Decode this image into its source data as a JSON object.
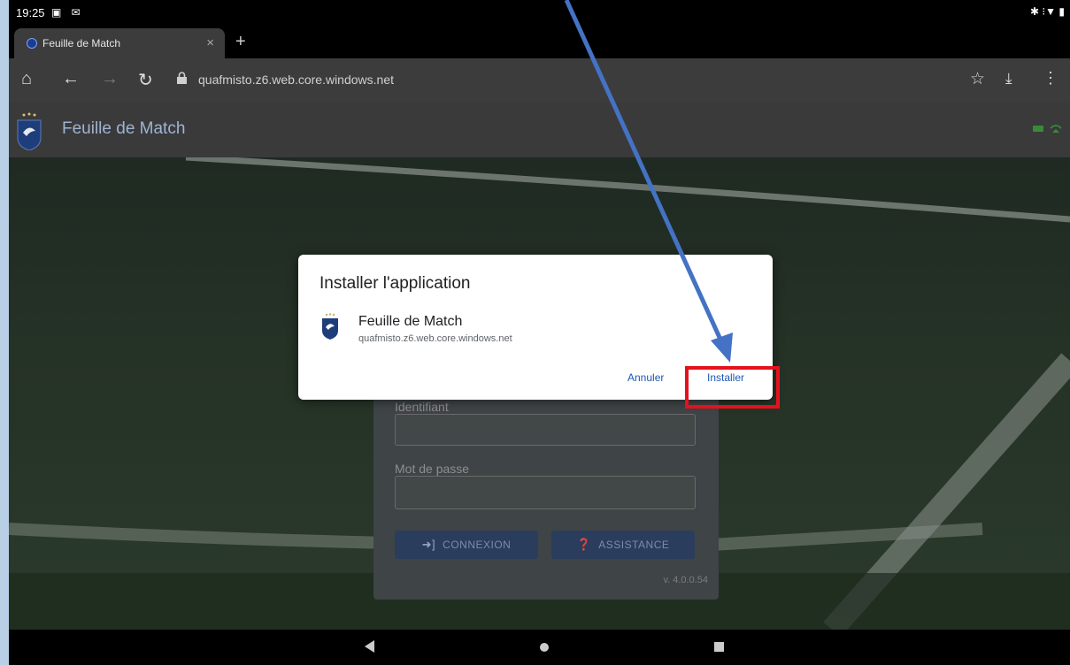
{
  "status_bar": {
    "time": "19:25",
    "left_icons": "▣ ✉",
    "right_icons": "✱ ⁝▼ ▮"
  },
  "browser": {
    "tab_title": "Feuille de Match",
    "tab_close": "×",
    "new_tab": "+",
    "url": "quafmisto.z6.web.core.windows.net",
    "toolbar_icons": [
      "home-icon",
      "back-icon",
      "forward-icon",
      "reload-icon",
      "star-icon",
      "download-icon",
      "menu-icon"
    ]
  },
  "app_header": {
    "title": "Feuille de Match"
  },
  "login": {
    "id_label": "Identifiant",
    "password_label": "Mot de passe",
    "connexion_label": "CONNEXION",
    "assistance_label": "ASSISTANCE",
    "version": "v. 4.0.0.54"
  },
  "dialog": {
    "title": "Installer l'application",
    "app_name": "Feuille de Match",
    "app_url": "quafmisto.z6.web.core.windows.net",
    "cancel_label": "Annuler",
    "install_label": "Installer"
  },
  "colors": {
    "highlight": "#e3121c",
    "arrow": "#4472c4",
    "dialog_button": "#1a57b5"
  }
}
